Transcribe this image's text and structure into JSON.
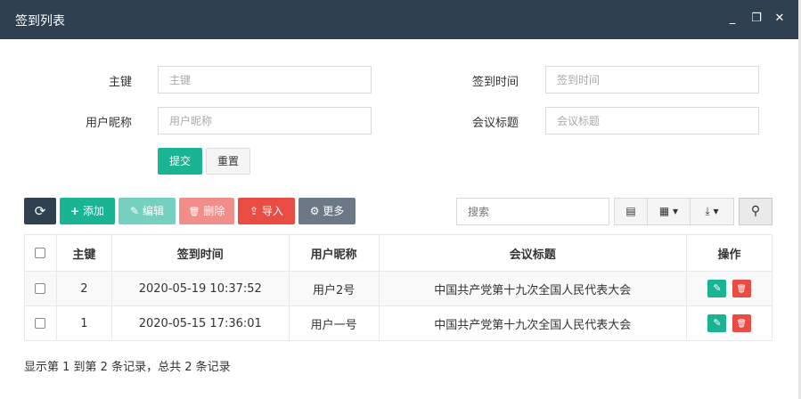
{
  "window": {
    "title": "签到列表",
    "minimize_glyph": "_",
    "maximize_glyph": "❐",
    "close_glyph": "✕"
  },
  "form": {
    "fields": [
      {
        "label": "主键",
        "placeholder": "主键"
      },
      {
        "label": "签到时间",
        "placeholder": "签到时间"
      },
      {
        "label": "用户昵称",
        "placeholder": "用户昵称"
      },
      {
        "label": "会议标题",
        "placeholder": "会议标题"
      }
    ],
    "submit_label": "提交",
    "reset_label": "重置"
  },
  "toolbar": {
    "refresh_icon": "⟳",
    "add_label": "添加",
    "edit_label": "编辑",
    "delete_label": "删除",
    "import_label": "导入",
    "more_label": "更多",
    "add_icon": "+",
    "edit_icon": "✎",
    "delete_icon": "🗑",
    "import_icon": "⇪",
    "more_icon": "⚙",
    "search_placeholder": "搜索",
    "toggle_icon": "▤",
    "columns_icon": "▦ ▾",
    "export_icon": "⤓ ▾",
    "search_icon": "⚲"
  },
  "table": {
    "columns": [
      "主键",
      "签到时间",
      "用户昵称",
      "会议标题",
      "操作"
    ],
    "rows": [
      {
        "id": "2",
        "time": "2020-05-19 10:37:52",
        "nickname": "用户2号",
        "title": "中国共产党第十九次全国人民代表大会"
      },
      {
        "id": "1",
        "time": "2020-05-15 17:36:01",
        "nickname": "用户一号",
        "title": "中国共产党第十九次全国人民代表大会"
      }
    ]
  },
  "pagination": {
    "summary": "显示第 1 到第 2 条记录，总共 2 条记录"
  },
  "colors": {
    "titlebar": "#2f4050",
    "primary": "#1ab394",
    "danger": "#e84c43",
    "gray": "#6c7886"
  }
}
